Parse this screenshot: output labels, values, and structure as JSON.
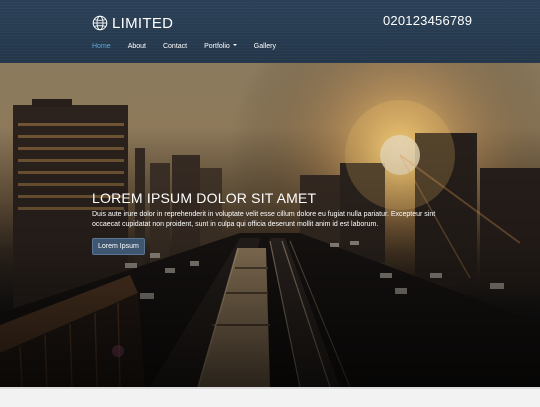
{
  "header": {
    "brand": "LIMITED",
    "brand_icon": "globe-icon",
    "phone": "020123456789",
    "background": "#2c4158",
    "active_color": "#5fa7d9"
  },
  "nav": {
    "items": [
      {
        "label": "Home",
        "active": true
      },
      {
        "label": "About"
      },
      {
        "label": "Contact"
      },
      {
        "label": "Portfolio",
        "has_dropdown": true
      },
      {
        "label": "Gallery"
      }
    ]
  },
  "hero": {
    "title": "LOREM IPSUM DOLOR SIT AMET",
    "text": "Duis aute irure dolor in reprehenderit in voluptate velit esse cillum dolore eu fugiat nulla pariatur. Excepteur sint occaecat cupidatat non proident, sunt in culpa qui officia deserunt mollit anim id est laborum.",
    "button_label": "Lorem Ipsum",
    "image": "city highway at sunset with train"
  }
}
